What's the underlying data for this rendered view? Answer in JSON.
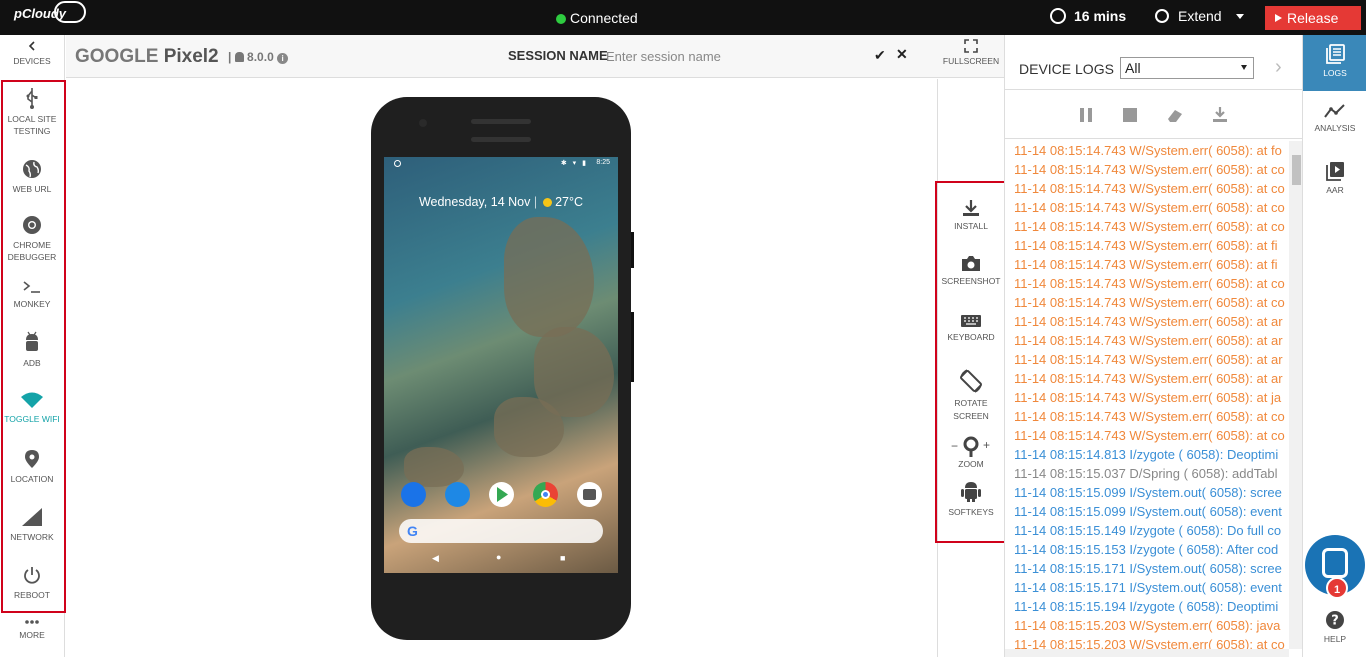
{
  "topbar": {
    "logo": "pCloudy",
    "connection": "Connected",
    "timer": "16 mins",
    "extend": "Extend",
    "release": "Release"
  },
  "leftbar": {
    "back": "DEVICES",
    "items": [
      {
        "label": "LOCAL SITE TESTING",
        "icon": "usb-icon"
      },
      {
        "label": "WEB URL",
        "icon": "globe-icon"
      },
      {
        "label": "CHROME DEBUGGER",
        "icon": "chrome-icon"
      },
      {
        "label": "MONKEY",
        "icon": "terminal-icon"
      },
      {
        "label": "ADB",
        "icon": "android-icon"
      },
      {
        "label": "TOGGLE WIFI",
        "icon": "wifi-icon"
      },
      {
        "label": "LOCATION",
        "icon": "location-pin-icon"
      },
      {
        "label": "NETWORK",
        "icon": "signal-icon"
      },
      {
        "label": "REBOOT",
        "icon": "power-icon"
      }
    ],
    "more": "MORE"
  },
  "header": {
    "brand": "GOOGLE",
    "model": "Pixel2",
    "separator": "|",
    "android_version": "8.0.0",
    "session_label": "SESSION NAME",
    "session_placeholder": "Enter session name",
    "fullscreen": "FULLSCREEN"
  },
  "device": {
    "status_time": "8:25",
    "date": "Wednesday, 14 Nov",
    "weather": "27°C"
  },
  "rightpanel": {
    "items": [
      {
        "label": "INSTALL",
        "icon": "download-icon"
      },
      {
        "label": "SCREENSHOT",
        "icon": "camera-icon"
      },
      {
        "label": "KEYBOARD",
        "icon": "keyboard-icon"
      },
      {
        "label": "ROTATE SCREEN",
        "icon": "rotate-icon"
      },
      {
        "label": "ZOOM",
        "icon": "magnifier-icon",
        "minus": "−",
        "plus": "+"
      },
      {
        "label": "SOFTKEYS",
        "icon": "android-icon"
      }
    ]
  },
  "logs": {
    "title": "DEVICE LOGS",
    "filter": "All",
    "lines": [
      {
        "text": "11-14 08:15:14.743 W/System.err( 6058): at fo",
        "level": "w"
      },
      {
        "text": "11-14 08:15:14.743 W/System.err( 6058): at co",
        "level": "w"
      },
      {
        "text": "11-14 08:15:14.743 W/System.err( 6058): at co",
        "level": "w"
      },
      {
        "text": "11-14 08:15:14.743 W/System.err( 6058): at co",
        "level": "w"
      },
      {
        "text": "11-14 08:15:14.743 W/System.err( 6058): at co",
        "level": "w"
      },
      {
        "text": "11-14 08:15:14.743 W/System.err( 6058): at fi",
        "level": "w"
      },
      {
        "text": "11-14 08:15:14.743 W/System.err( 6058): at fi",
        "level": "w"
      },
      {
        "text": "11-14 08:15:14.743 W/System.err( 6058): at co",
        "level": "w"
      },
      {
        "text": "11-14 08:15:14.743 W/System.err( 6058): at co",
        "level": "w"
      },
      {
        "text": "11-14 08:15:14.743 W/System.err( 6058): at ar",
        "level": "w"
      },
      {
        "text": "11-14 08:15:14.743 W/System.err( 6058): at ar",
        "level": "w"
      },
      {
        "text": "11-14 08:15:14.743 W/System.err( 6058): at ar",
        "level": "w"
      },
      {
        "text": "11-14 08:15:14.743 W/System.err( 6058): at ar",
        "level": "w"
      },
      {
        "text": "11-14 08:15:14.743 W/System.err( 6058): at ja",
        "level": "w"
      },
      {
        "text": "11-14 08:15:14.743 W/System.err( 6058): at co",
        "level": "w"
      },
      {
        "text": "11-14 08:15:14.743 W/System.err( 6058): at co",
        "level": "w"
      },
      {
        "text": "11-14 08:15:14.813 I/zygote ( 6058): Deoptimi",
        "level": "i"
      },
      {
        "text": "11-14 08:15:15.037 D/Spring ( 6058): addTabl",
        "level": "d"
      },
      {
        "text": "11-14 08:15:15.099 I/System.out( 6058): scree",
        "level": "i"
      },
      {
        "text": "11-14 08:15:15.099 I/System.out( 6058): event",
        "level": "i"
      },
      {
        "text": "11-14 08:15:15.149 I/zygote ( 6058): Do full co",
        "level": "i"
      },
      {
        "text": "11-14 08:15:15.153 I/zygote ( 6058): After cod",
        "level": "i"
      },
      {
        "text": "11-14 08:15:15.171 I/System.out( 6058): scree",
        "level": "i"
      },
      {
        "text": "11-14 08:15:15.171 I/System.out( 6058): event",
        "level": "i"
      },
      {
        "text": "11-14 08:15:15.194 I/zygote ( 6058): Deoptimi",
        "level": "i"
      },
      {
        "text": "11-14 08:15:15.203 W/System.err( 6058): java",
        "level": "w"
      },
      {
        "text": "11-14 08:15:15.203 W/System.err( 6058): at co",
        "level": "w"
      }
    ]
  },
  "rail": {
    "items": [
      {
        "label": "LOGS",
        "icon": "logs-icon"
      },
      {
        "label": "ANALYSIS",
        "icon": "analysis-icon"
      },
      {
        "label": "AAR",
        "icon": "play-icon"
      }
    ],
    "help": "HELP",
    "chat_badge": "1"
  }
}
